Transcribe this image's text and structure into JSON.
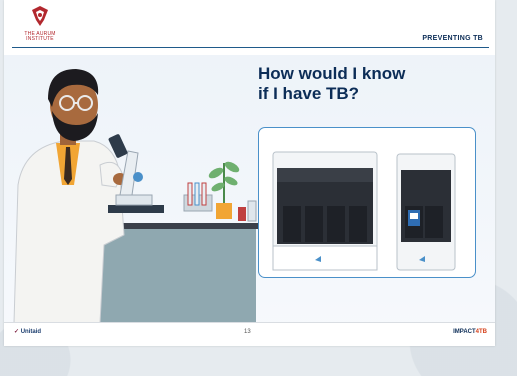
{
  "header": {
    "org_name": "THE AURUM INSTITUTE",
    "title": "PREVENTING TB"
  },
  "main": {
    "question_line1": "How would I know",
    "question_line2": "if I have TB?",
    "illustration": "scientist-with-microscope",
    "device_image": "genexpert-machines"
  },
  "footer": {
    "left_brand": "Unitaid",
    "page_number": "13",
    "right_brand_main": "IMPACT",
    "right_brand_accent": "4TB"
  },
  "colors": {
    "navy": "#0c2d57",
    "accent_blue": "#4a90c9",
    "aurum_red": "#b2282e",
    "impact_orange": "#d6411b"
  }
}
